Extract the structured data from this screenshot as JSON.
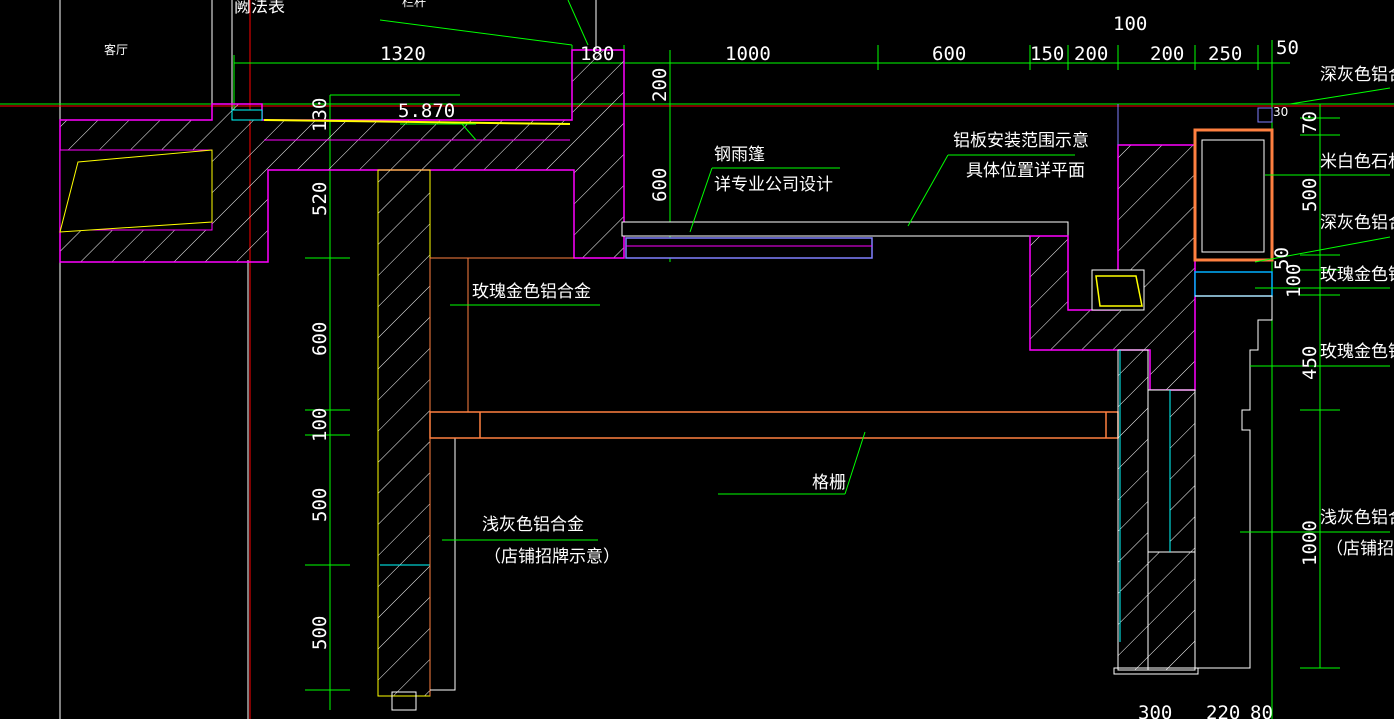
{
  "drawing": {
    "colors": {
      "background": "#000000",
      "dimension": "#00ff00",
      "concrete": "#ff00ff",
      "hatch": "#ffffff",
      "accent": "#ffff00",
      "metal": "#ff8040",
      "glass": "#00ffff",
      "axis": "#ff0000",
      "frame": "#8080ff"
    },
    "room_label": "客厅",
    "top_partial_1": "阙法表",
    "top_partial_2": "栏杆",
    "elevation_mark": "5.870",
    "top_dims": {
      "d1320": "1320",
      "d180": "180",
      "d1000": "1000",
      "d600": "600",
      "d150": "150",
      "d200a": "200",
      "d200b": "200",
      "d250": "250",
      "d100": "100",
      "d50": "50"
    },
    "left_dims": {
      "d130": "130",
      "d520": "520",
      "d600": "600",
      "d100": "100",
      "d500a": "500",
      "d500b": "500"
    },
    "mid_dims": {
      "d200": "200",
      "d600": "600"
    },
    "right_dims": {
      "d30": "30",
      "d70": "70",
      "d500": "500",
      "d50": "50",
      "d100": "100",
      "d450": "450",
      "d1000": "1000"
    },
    "bottom_dims": {
      "d300": "300",
      "d220": "220",
      "d80": "80"
    },
    "labels": {
      "steel_canopy_1": "钢雨篷",
      "steel_canopy_2": "详专业公司设计",
      "alu_range_1": "铝板安装范围示意",
      "alu_range_2": "具体位置详平面",
      "rose_gold": "玫瑰金色铝合金",
      "grille": "格栅",
      "light_gray_1": "浅灰色铝合金",
      "light_gray_2": "（店铺招牌示意）"
    },
    "right_labels": {
      "r1": "深灰色铝合",
      "r2": "米白色石材",
      "r3": "深灰色铝合",
      "r4": "玫瑰金色铝",
      "r5": "玫瑰金色铝",
      "r6": "浅灰色铝合",
      "r7": "（店铺招牌"
    }
  }
}
